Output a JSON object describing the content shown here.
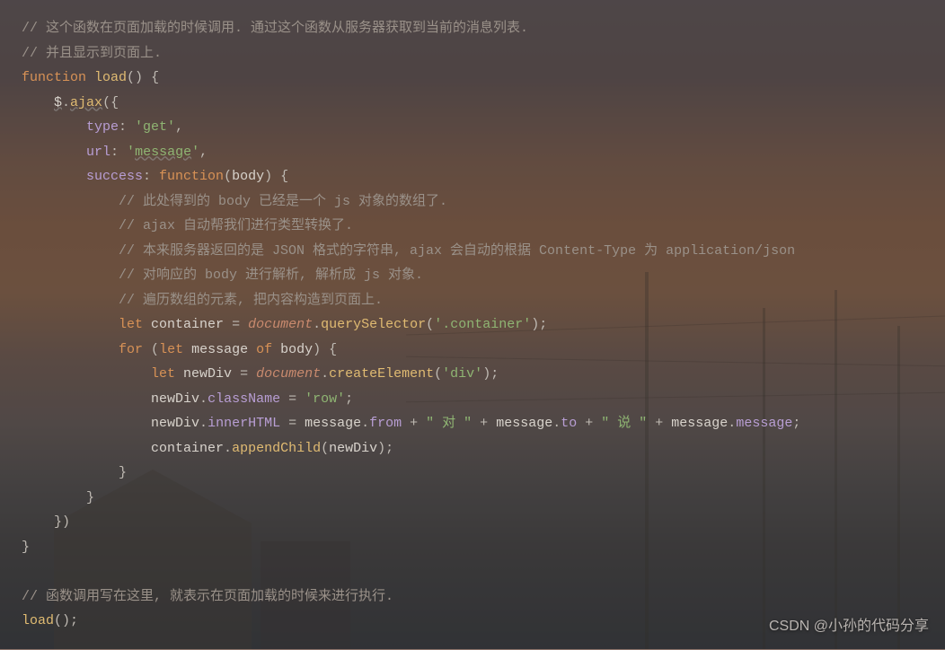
{
  "code": {
    "c1": "// 这个函数在页面加载的时候调用. 通过这个函数从服务器获取到当前的消息列表.",
    "c2": "// 并且显示到页面上.",
    "kw_function": "function",
    "fn_load": "load",
    "p_open1": "()",
    "brace_open1": " {",
    "jq": "$",
    "dot1": ".",
    "ajax": "ajax",
    "p_ajax_open": "({",
    "prop_type": "type",
    "colon1": ": ",
    "str_get": "'get'",
    "comma1": ",",
    "prop_url": "url",
    "colon2": ": ",
    "str_message": "'",
    "str_message_inner": "message",
    "str_message_close": "'",
    "comma2": ",",
    "prop_success": "success",
    "colon3": ": ",
    "kw_function2": "function",
    "p_body": "(",
    "param_body": "body",
    "p_body_close": ")",
    "brace_open2": " {",
    "c3": "// 此处得到的 body 已经是一个 js 对象的数组了.",
    "c4": "// ajax 自动帮我们进行类型转换了.",
    "c5": "// 本来服务器返回的是 JSON 格式的字符串, ajax 会自动的根据 Content-Type 为 application/json",
    "c6": "// 对响应的 body 进行解析, 解析成 js 对象.",
    "c7": "// 遍历数组的元素, 把内容构造到页面上.",
    "kw_let1": "let",
    "var_container": " container ",
    "eq1": "=",
    "sp1": " ",
    "obj_document1": "document",
    "dot2": ".",
    "m_querySelector": "querySelector",
    "p_qs_open": "(",
    "str_container": "'.container'",
    "p_qs_close": ")",
    "semi1": ";",
    "kw_for": "for",
    "p_for_open": " (",
    "kw_let2": "let",
    "var_message": " message ",
    "kw_of": "of",
    "var_body2": " body",
    "p_for_close": ")",
    "brace_open3": " {",
    "kw_let3": "let",
    "var_newDiv": " newDiv ",
    "eq2": "=",
    "sp2": " ",
    "obj_document2": "document",
    "dot3": ".",
    "m_createElement": "createElement",
    "p_ce_open": "(",
    "str_div": "'div'",
    "p_ce_close": ")",
    "semi2": ";",
    "var_newDiv2": "newDiv",
    "dot4": ".",
    "prop_className": "className",
    "eq3": " = ",
    "str_row": "'row'",
    "semi3": ";",
    "var_newDiv3": "newDiv",
    "dot5": ".",
    "prop_innerHTML": "innerHTML",
    "eq4": " = ",
    "var_message2": "message",
    "dot6": ".",
    "prop_from": "from",
    "plus1": " + ",
    "str_dui": "\" 对 \"",
    "plus2": " + ",
    "var_message3": "message",
    "dot7": ".",
    "prop_to": "to",
    "plus3": " + ",
    "str_shuo": "\" 说 \"",
    "plus4": " + ",
    "var_message4": "message",
    "dot8": ".",
    "prop_message": "message",
    "semi4": ";",
    "var_container2": "container",
    "dot9": ".",
    "m_appendChild": "appendChild",
    "p_ac_open": "(",
    "var_newDiv4": "newDiv",
    "p_ac_close": ")",
    "semi5": ";",
    "brace_close3": "}",
    "brace_close2": "}",
    "p_ajax_close": "})",
    "brace_close1": "}",
    "c8": "// 函数调用写在这里, 就表示在页面加载的时候来进行执行.",
    "fn_load2": "load",
    "p_load2": "()",
    "semi6": ";"
  },
  "watermark": "CSDN @小孙的代码分享"
}
